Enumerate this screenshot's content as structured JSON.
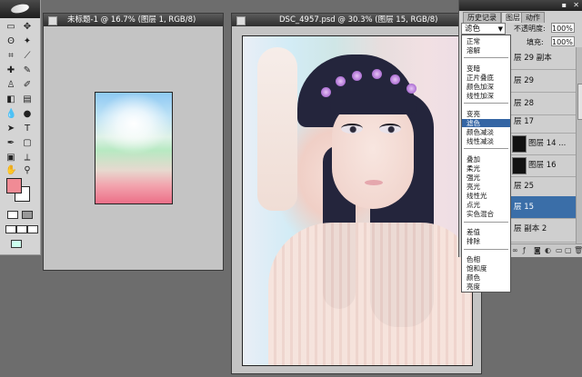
{
  "doc1": {
    "title": "未标题-1 @ 16.7% (图层 1, RGB/8)"
  },
  "doc2": {
    "title": "DSC_4957.psd @ 30.3% (图层 15, RGB/8)"
  },
  "layers_panel": {
    "tabs": [
      "历史记录",
      "图层",
      "动作"
    ],
    "blend_mode": "滤色",
    "opacity_label": "不透明度:",
    "opacity_value": "100%",
    "fill_label": "填充:",
    "fill_value": "100%",
    "layers": [
      {
        "name": "层 29 副本",
        "thumb": false,
        "selected": false
      },
      {
        "name": "层 29",
        "thumb": false,
        "selected": false
      },
      {
        "name": "层 28",
        "thumb": false,
        "selected": false
      },
      {
        "name": "层 17",
        "thumb": false,
        "selected": false
      },
      {
        "name": "图层 14 ...",
        "thumb": true,
        "selected": false
      },
      {
        "name": "图层 16",
        "thumb": true,
        "selected": false
      },
      {
        "name": "层 25",
        "thumb": false,
        "selected": false
      },
      {
        "name": "层 15",
        "thumb": false,
        "selected": true
      },
      {
        "name": "层 副本 2",
        "thumb": false,
        "selected": false
      }
    ]
  },
  "blend_menu": {
    "groups": [
      [
        "正常",
        "溶解"
      ],
      [
        "变暗",
        "正片叠底",
        "颜色加深",
        "线性加深"
      ],
      [
        "变亮",
        "滤色",
        "颜色减淡",
        "线性减淡"
      ],
      [
        "叠加",
        "柔光",
        "强光",
        "亮光",
        "线性光",
        "点光",
        "实色混合"
      ],
      [
        "差值",
        "排除"
      ],
      [
        "色相",
        "饱和度",
        "颜色",
        "亮度"
      ]
    ],
    "selected": "滤色"
  },
  "colors": {
    "foreground": "#f08b95",
    "background": "#ffffff",
    "selection": "#3465a4"
  }
}
